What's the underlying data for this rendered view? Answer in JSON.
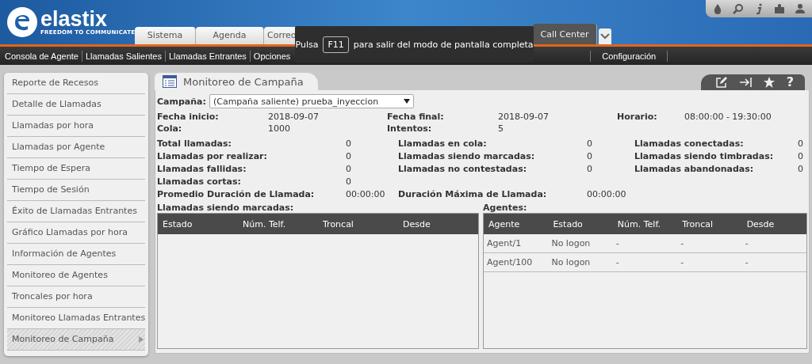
{
  "logo": {
    "name": "elastix",
    "tagline": "FREEDOM TO COMMUNICATE"
  },
  "tabs": [
    {
      "label": "Sistema",
      "selected": false
    },
    {
      "label": "Agenda",
      "selected": false
    },
    {
      "label": "Correo",
      "selected": false
    },
    {
      "label": "Call Center",
      "selected": true
    }
  ],
  "submenu": [
    {
      "label": "Consola de Agente"
    },
    {
      "label": "Llamadas Salientes"
    },
    {
      "label": "Llamadas Entrantes"
    },
    {
      "label": "Opciones"
    },
    {
      "label": "Configuración"
    }
  ],
  "fullscreen_notice": {
    "before": "Pulsa",
    "key": "F11",
    "after": "para salir del modo de pantalla completa"
  },
  "sidebar": {
    "items": [
      {
        "label": "Reporte de Recesos",
        "selected": false
      },
      {
        "label": "Detalle de Llamadas",
        "selected": false
      },
      {
        "label": "Llamadas por hora",
        "selected": false
      },
      {
        "label": "Llamadas por Agente",
        "selected": false
      },
      {
        "label": "Tiempo de Espera",
        "selected": false
      },
      {
        "label": "Tiempo de Sesión",
        "selected": false
      },
      {
        "label": "Éxito de Llamadas Entrantes",
        "selected": false
      },
      {
        "label": "Gráfico Llamadas por hora",
        "selected": false
      },
      {
        "label": "Información de Agentes",
        "selected": false
      },
      {
        "label": "Monitoreo de Agentes",
        "selected": false
      },
      {
        "label": "Troncales por hora",
        "selected": false
      },
      {
        "label": "Monitoreo Llamadas Entrantes",
        "selected": false
      },
      {
        "label": "Monitoreo de Campaña",
        "selected": true
      }
    ]
  },
  "panel": {
    "title": "Monitoreo de Campaña",
    "help_label": "?",
    "campaign_label": "Campaña:",
    "campaign_value": "(Campaña saliente) prueba_inyeccion",
    "info": [
      [
        {
          "label": "Fecha inicio:",
          "value": "2018-09-07"
        },
        {
          "label": "Fecha final:",
          "value": "2018-09-07"
        },
        {
          "label": "Horario:",
          "value": "08:00:00 - 19:30:00"
        }
      ],
      [
        {
          "label": "Cola:",
          "value": "1000"
        },
        {
          "label": "Intentos:",
          "value": "5"
        }
      ]
    ],
    "stats": [
      [
        {
          "label": "Total llamadas:",
          "value": "0"
        },
        {
          "label": "Llamadas en cola:",
          "value": "0"
        },
        {
          "label": "Llamadas conectadas:",
          "value": "0"
        }
      ],
      [
        {
          "label": "Llamadas por realizar:",
          "value": "0"
        },
        {
          "label": "Llamadas siendo marcadas:",
          "value": "0"
        },
        {
          "label": "Llamadas siendo timbradas:",
          "value": "0"
        }
      ],
      [
        {
          "label": "Llamadas fallidas:",
          "value": "0"
        },
        {
          "label": "Llamadas no contestadas:",
          "value": "0"
        },
        {
          "label": "Llamadas abandonadas:",
          "value": "0"
        }
      ],
      [
        {
          "label": "Llamadas cortas:",
          "value": "0"
        }
      ],
      [
        {
          "label": "Promedio Duración de Llamada:",
          "value": "00:00:00"
        },
        {
          "label": "Duración Máxima de Llamada:",
          "value": "00:00:00"
        }
      ]
    ],
    "calls_table": {
      "title": "Llamadas siendo marcadas:",
      "columns": [
        "Estado",
        "Núm. Telf.",
        "Troncal",
        "Desde"
      ]
    },
    "agents_table": {
      "title": "Agentes:",
      "columns": [
        "Agente",
        "Estado",
        "Núm. Telf.",
        "Troncal",
        "Desde"
      ],
      "rows": [
        [
          "Agent/1",
          "No logon",
          "-",
          "-",
          "-"
        ],
        [
          "Agent/100",
          "No logon",
          "-",
          "-",
          "-"
        ]
      ]
    }
  }
}
